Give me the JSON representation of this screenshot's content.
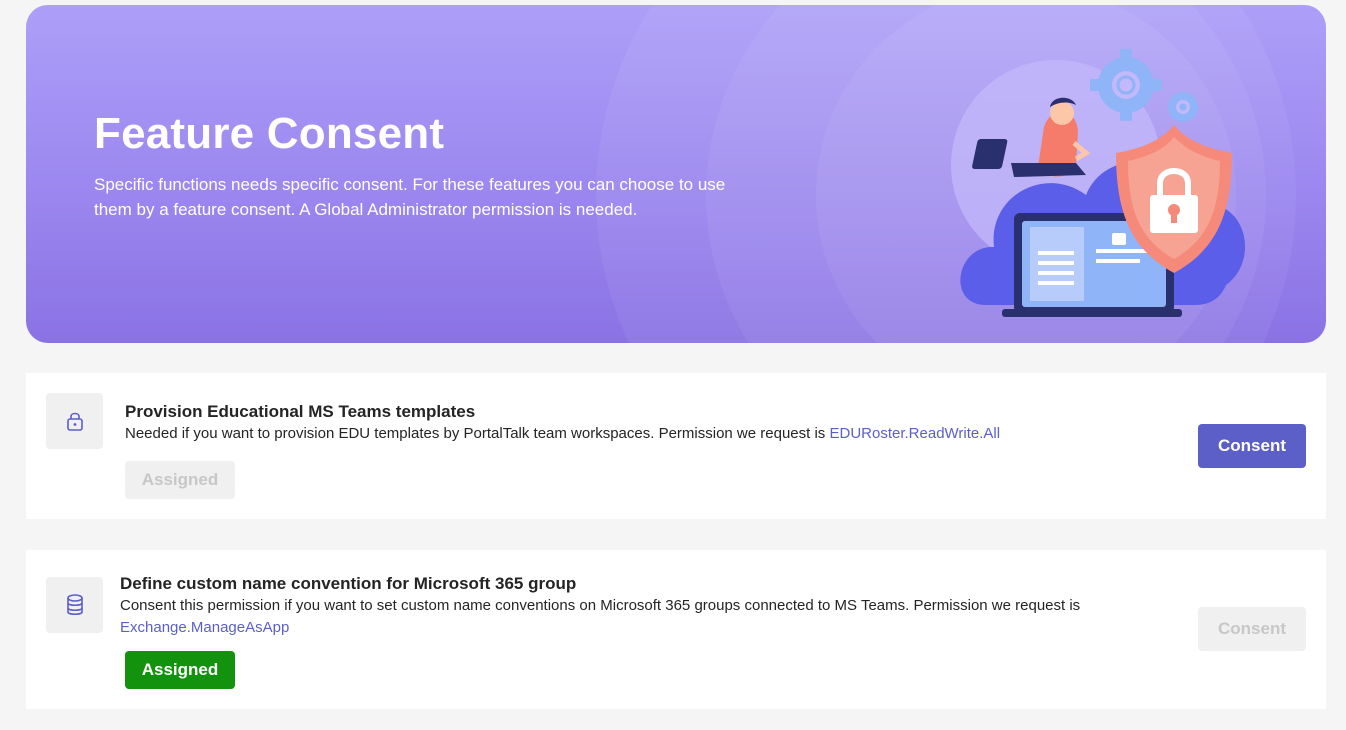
{
  "hero": {
    "title": "Feature Consent",
    "description": "Specific functions needs specific consent. For these features you can choose to use them by a feature consent. A Global Administrator permission is needed."
  },
  "features": [
    {
      "icon": "lock-icon",
      "title": "Provision Educational MS Teams templates",
      "description": "Needed if you want to provision EDU templates by PortalTalk team workspaces. Permission we request is",
      "permission": "EDURoster.ReadWrite.All",
      "status": "Assigned",
      "status_state": "not-assigned",
      "button": "Consent",
      "button_enabled": true
    },
    {
      "icon": "database-icon",
      "title": "Define custom name convention for Microsoft 365 group",
      "description": "Consent this permission if you want to set custom name conventions on Microsoft 365 groups connected to MS Teams. Permission we request is",
      "permission": "Exchange.ManageAsApp",
      "status": "Assigned",
      "status_state": "assigned",
      "button": "Consent",
      "button_enabled": false
    }
  ],
  "colors": {
    "accent": "#5b5fc7",
    "success": "#13930d",
    "hero_top": "#ad9ff8",
    "hero_bottom": "#8a72e4",
    "disabled_bg": "#f0f0f0",
    "disabled_text": "#c7c7c7"
  }
}
